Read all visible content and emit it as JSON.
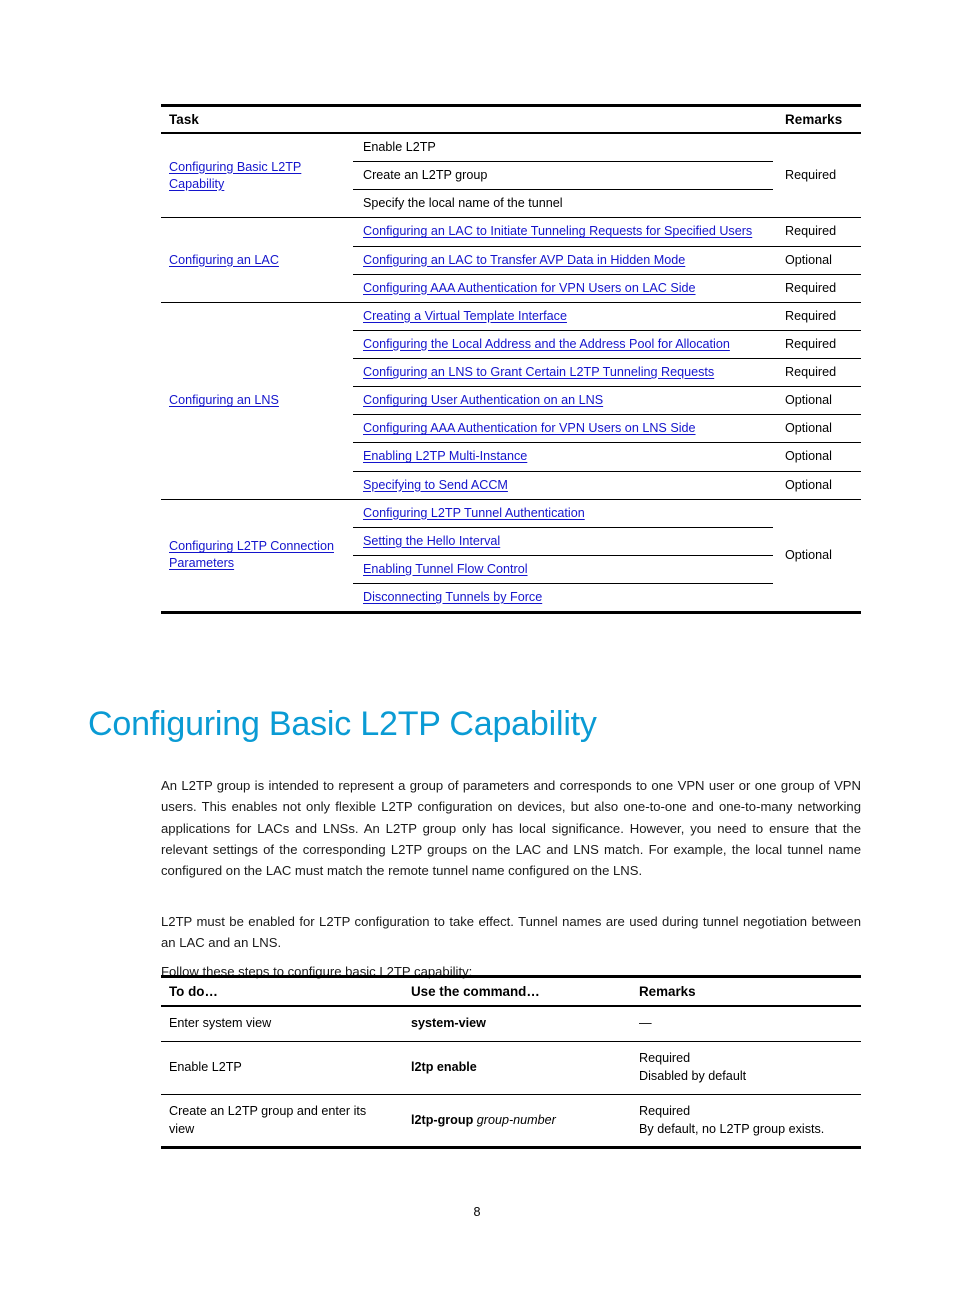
{
  "page": {
    "number": "8"
  },
  "task_table": {
    "headers": {
      "task": "Task",
      "sub": "",
      "remarks": "Remarks"
    },
    "groups": [
      {
        "task": "Configuring Basic L2TP Capability",
        "task_is_link": true,
        "remark": "Required",
        "items": [
          {
            "label": "Enable L2TP",
            "is_link": false
          },
          {
            "label": "Create an L2TP group",
            "is_link": false
          },
          {
            "label": "Specify the local name of the tunnel",
            "is_link": false
          }
        ]
      },
      {
        "task": "Configuring an LAC",
        "task_is_link": true,
        "items": [
          {
            "label": "Configuring an LAC to Initiate Tunneling Requests for Specified Users",
            "is_link": true,
            "remark": "Required"
          },
          {
            "label": "Configuring an LAC to Transfer AVP Data in Hidden Mode",
            "is_link": true,
            "remark": "Optional"
          },
          {
            "label": "Configuring AAA Authentication for VPN Users on LAC Side",
            "is_link": true,
            "remark": "Required"
          }
        ]
      },
      {
        "task": "Configuring an LNS",
        "task_is_link": true,
        "items": [
          {
            "label": "Creating a Virtual Template Interface",
            "is_link": true,
            "remark": "Required"
          },
          {
            "label": "Configuring the Local Address and the Address Pool for Allocation",
            "is_link": true,
            "remark": "Required"
          },
          {
            "label": "Configuring an LNS to Grant Certain L2TP Tunneling Requests",
            "is_link": true,
            "remark": "Required"
          },
          {
            "label": "Configuring User Authentication on an LNS",
            "is_link": true,
            "remark": "Optional"
          },
          {
            "label": "Configuring AAA Authentication for VPN Users on LNS Side",
            "is_link": true,
            "remark": "Optional"
          },
          {
            "label": "Enabling L2TP Multi-Instance",
            "is_link": true,
            "remark": "Optional"
          },
          {
            "label": "Specifying to Send ACCM",
            "is_link": true,
            "remark": "Optional"
          }
        ]
      },
      {
        "task": "Configuring L2TP Connection Parameters",
        "task_is_link": true,
        "remark": "Optional",
        "items": [
          {
            "label": "Configuring L2TP Tunnel Authentication",
            "is_link": true
          },
          {
            "label": "Setting the Hello Interval",
            "is_link": true
          },
          {
            "label": "Enabling Tunnel Flow Control",
            "is_link": true
          },
          {
            "label": "Disconnecting Tunnels by Force",
            "is_link": true
          }
        ]
      }
    ]
  },
  "section": {
    "heading": "Configuring Basic L2TP Capability",
    "paragraph_1": "An L2TP group is intended to represent a group of parameters and corresponds to one VPN user or one group of VPN users. This enables not only flexible L2TP configuration on devices, but also one-to-one and one-to-many networking applications for LACs and LNSs. An L2TP group only has local significance. However, you need to ensure that the relevant settings of the corresponding L2TP groups on the LAC and LNS match. For example, the local tunnel name configured on the LAC must match the remote tunnel name configured on the LNS.",
    "paragraph_2": "L2TP must be enabled for L2TP configuration to take effect. Tunnel names are used during tunnel negotiation between an LAC and an LNS.",
    "paragraph_3": "Follow these steps to configure basic L2TP capability:"
  },
  "steps_table": {
    "headers": {
      "todo": "To do…",
      "command": "Use the command…",
      "remarks": "Remarks"
    },
    "rows": [
      {
        "todo": "Enter system view",
        "command": "system-view",
        "command_arg": "",
        "remark_1": "—",
        "remark_2": ""
      },
      {
        "todo": "Enable L2TP",
        "command": "l2tp enable",
        "command_arg": "",
        "remark_1": "Required",
        "remark_2": "Disabled by default"
      },
      {
        "todo": "Create an L2TP group and enter its view",
        "command": "l2tp-group",
        "command_arg": "group-number",
        "remark_1": "Required",
        "remark_2": "By default, no L2TP group exists."
      }
    ]
  },
  "colors": {
    "heading": "#0a9bd4",
    "link": "#1414cc",
    "rule": "#000000"
  }
}
